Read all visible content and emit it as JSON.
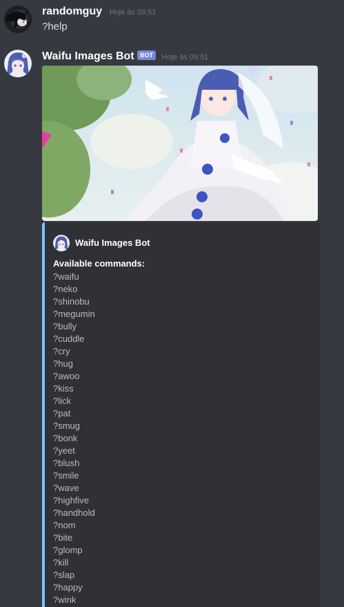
{
  "messages": [
    {
      "author": "randomguy",
      "timestamp": "Hoje às 09:51",
      "text": "?help"
    },
    {
      "author": "Waifu Images Bot",
      "badge": "BOT",
      "timestamp": "Hoje às 09:51",
      "embed": {
        "author_name": "Waifu Images Bot",
        "field_name": "Available commands:",
        "commands": [
          "?waifu",
          "?neko",
          "?shinobu",
          "?megumin",
          "?bully",
          "?cuddle",
          "?cry",
          "?hug",
          "?awoo",
          "?kiss",
          "?lick",
          "?pat",
          "?smug",
          "?bonk",
          "?yeet",
          "?blush",
          "?smile",
          "?wave",
          "?highfive",
          "?handhold",
          "?nom",
          "?bite",
          "?glomp",
          "?kill",
          "?slap",
          "?happy",
          "?wink"
        ]
      }
    }
  ],
  "colors": {
    "background": "#36393f",
    "embed_background": "#2f3136",
    "embed_border": "#87c1ef",
    "bot_badge": "#7289da",
    "timestamp": "#72767d",
    "text": "#dcddde"
  },
  "icons": {
    "user_avatar": "dark-haired-avatar",
    "bot_avatar": "blue-haired-anime-avatar",
    "attachment": "anime-bride-image"
  }
}
